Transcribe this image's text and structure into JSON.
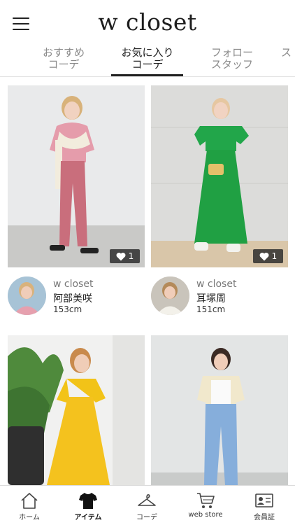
{
  "header": {
    "logo": "w closet",
    "menu_icon": "hamburger-menu-icon"
  },
  "tabs": [
    {
      "line1": "おすすめ",
      "line2": "コーデ",
      "active": false
    },
    {
      "line1": "お気に入り",
      "line2": "コーデ",
      "active": true
    },
    {
      "line1": "フォロー",
      "line2": "スタッフ",
      "active": false
    },
    {
      "line1": "ス",
      "line2": "",
      "active": false
    }
  ],
  "posts": [
    {
      "likes": "1",
      "brand": "w closet",
      "name": "阿部美咲",
      "height": "153cm"
    },
    {
      "likes": "1",
      "brand": "w closet",
      "name": "耳塚周",
      "height": "151cm"
    },
    {
      "likes": "",
      "brand": "",
      "name": "",
      "height": ""
    },
    {
      "likes": "",
      "brand": "",
      "name": "",
      "height": ""
    }
  ],
  "bottom_nav": [
    {
      "label": "ホーム",
      "icon": "home-icon",
      "active": false
    },
    {
      "label": "アイテム",
      "icon": "tshirt-icon",
      "active": true
    },
    {
      "label": "コーデ",
      "icon": "hanger-icon",
      "active": false
    },
    {
      "label": "web store",
      "icon": "cart-icon",
      "active": false
    },
    {
      "label": "会員証",
      "icon": "member-card-icon",
      "active": false
    }
  ],
  "colors": {
    "text": "#222222",
    "tab_inactive": "#8a8a8a",
    "badge_bg": "#282828"
  }
}
